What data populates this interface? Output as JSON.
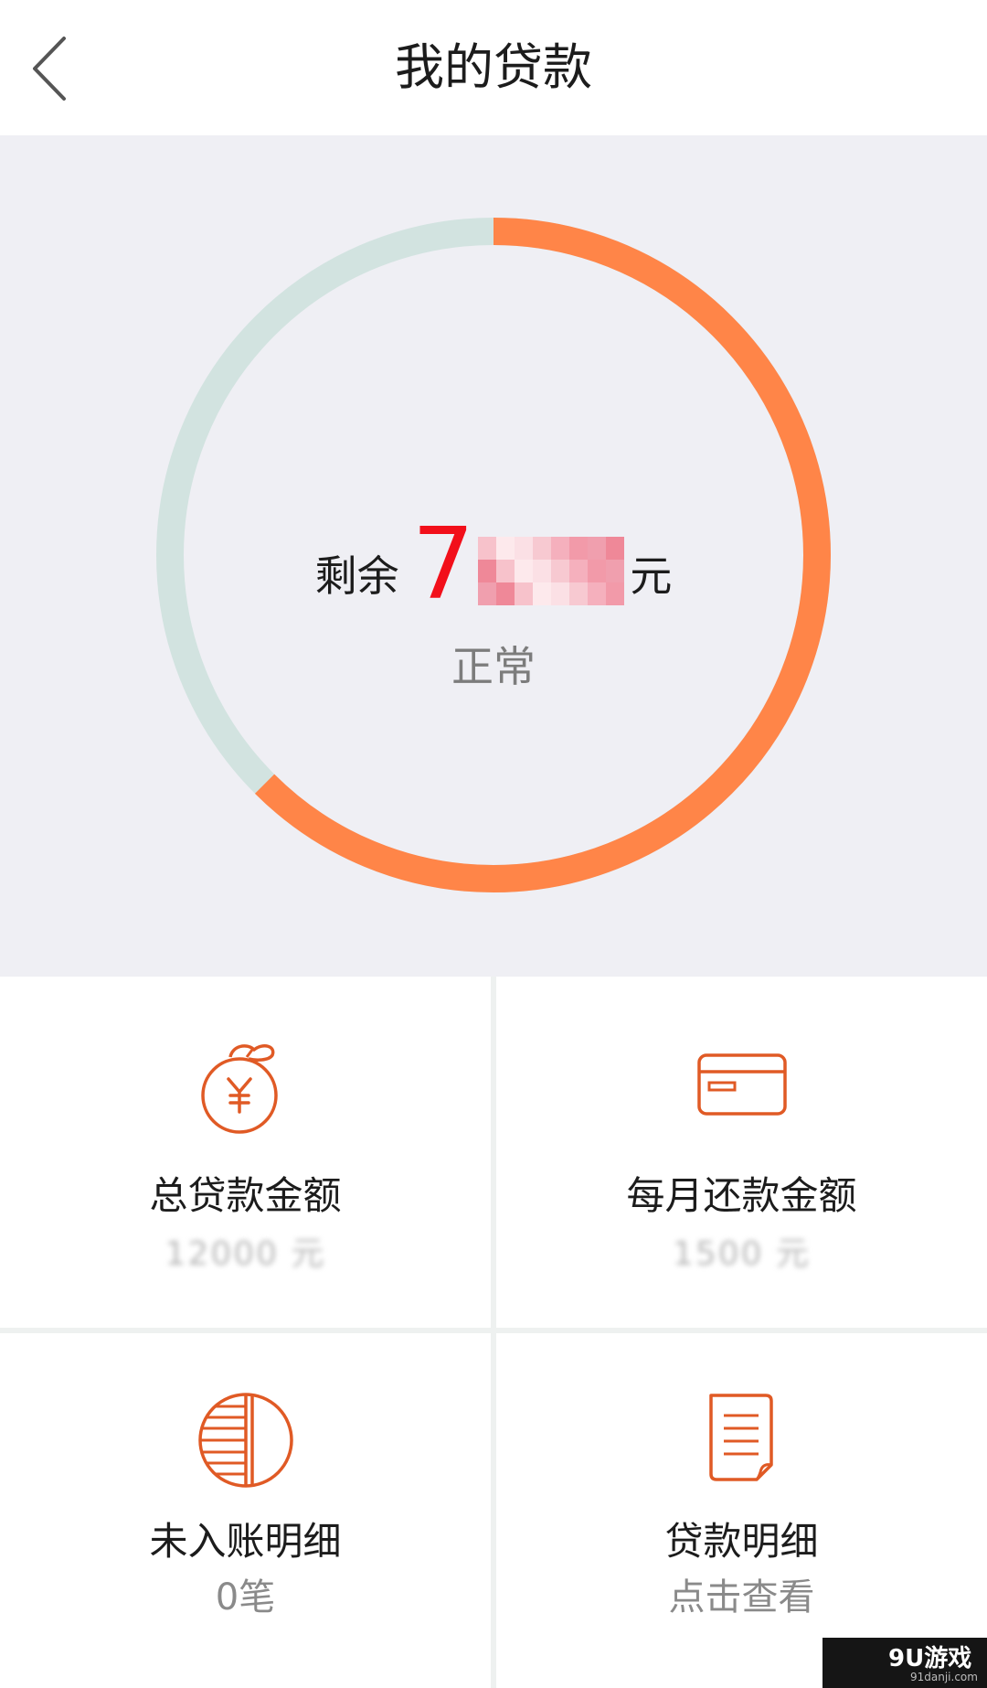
{
  "header": {
    "title": "我的贷款",
    "back_icon": "chevron-left-icon"
  },
  "summary": {
    "prefix": "剩余",
    "amount_visible_digit": "7",
    "unit": "元",
    "status": "正常",
    "repaid_fraction": 0.625,
    "colors": {
      "progress": "#ff8548",
      "track": "#d2e3e0",
      "amount": "#f20f1a"
    }
  },
  "tiles": [
    {
      "icon": "money-bag-yen-icon",
      "label": "总贷款金额",
      "value": "12000 元"
    },
    {
      "icon": "bank-card-icon",
      "label": "每月还款金额",
      "value": "1500 元"
    },
    {
      "icon": "half-striped-circle-icon",
      "label": "未入账明细",
      "value": "0笔"
    },
    {
      "icon": "document-icon",
      "label": "贷款明细",
      "value": "点击查看"
    }
  ],
  "icon_color": "#e05a25",
  "watermark": {
    "main": "9U游戏",
    "sub": "91danji.com"
  }
}
